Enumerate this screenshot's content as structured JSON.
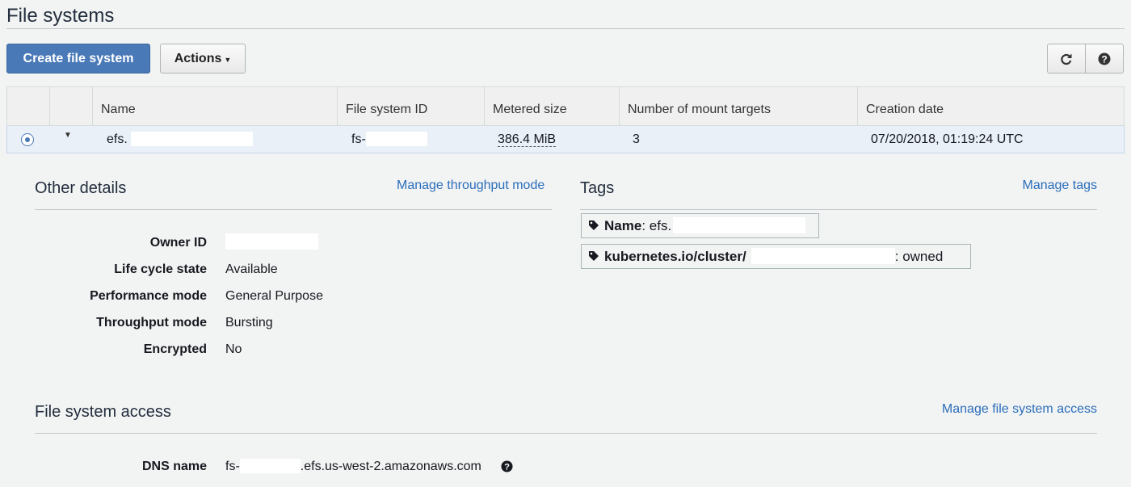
{
  "page": {
    "title": "File systems"
  },
  "toolbar": {
    "create_label": "Create file system",
    "actions_label": "Actions",
    "refresh_icon": "refresh-icon",
    "help_icon": "question-circle-icon"
  },
  "table": {
    "columns": [
      "Name",
      "File system ID",
      "Metered size",
      "Number of mount targets",
      "Creation date"
    ],
    "row": {
      "name": "efs.",
      "fs_id": "fs-",
      "size": "386.4 MiB",
      "mount_targets": "3",
      "created": "07/20/2018, 01:19:24 UTC"
    }
  },
  "details": {
    "title": "Other details",
    "manage_link": "Manage throughput mode",
    "fields": [
      {
        "label": "Owner ID",
        "value": ""
      },
      {
        "label": "Life cycle state",
        "value": "Available"
      },
      {
        "label": "Performance mode",
        "value": "General Purpose"
      },
      {
        "label": "Throughput mode",
        "value": "Bursting"
      },
      {
        "label": "Encrypted",
        "value": "No"
      }
    ]
  },
  "tags": {
    "title": "Tags",
    "manage_link": "Manage tags",
    "items": [
      {
        "key": "Name",
        "sep": ":",
        "value": "efs."
      },
      {
        "key": "kubernetes.io/cluster/",
        "sep": ":",
        "value": "owned"
      }
    ]
  },
  "access": {
    "title": "File system access",
    "manage_link": "Manage file system access",
    "dns_label": "DNS name",
    "dns_prefix": "fs-",
    "dns_suffix": ".efs.us-west-2.amazonaws.com"
  },
  "colors": {
    "primary": "#4a79b8",
    "link": "#2a6ebb",
    "selected_row": "#e9f0f8"
  }
}
